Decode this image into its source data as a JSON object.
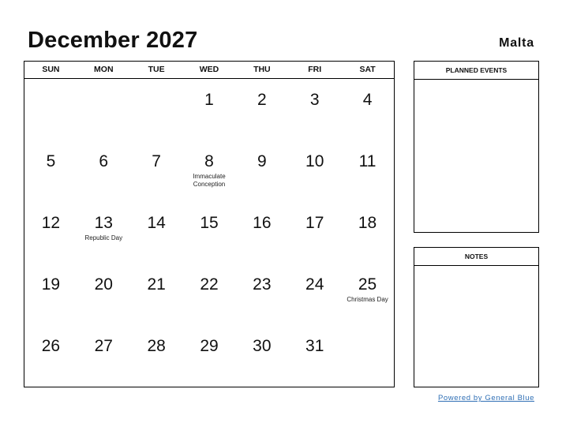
{
  "header": {
    "title": "December 2027",
    "country": "Malta"
  },
  "calendar": {
    "weekdays": [
      "SUN",
      "MON",
      "TUE",
      "WED",
      "THU",
      "FRI",
      "SAT"
    ],
    "weeks": [
      [
        {
          "day": ""
        },
        {
          "day": ""
        },
        {
          "day": ""
        },
        {
          "day": "1"
        },
        {
          "day": "2"
        },
        {
          "day": "3"
        },
        {
          "day": "4"
        }
      ],
      [
        {
          "day": "5"
        },
        {
          "day": "6"
        },
        {
          "day": "7"
        },
        {
          "day": "8",
          "holiday": "Immaculate Conception"
        },
        {
          "day": "9"
        },
        {
          "day": "10"
        },
        {
          "day": "11"
        }
      ],
      [
        {
          "day": "12"
        },
        {
          "day": "13",
          "holiday": "Republic Day"
        },
        {
          "day": "14"
        },
        {
          "day": "15"
        },
        {
          "day": "16"
        },
        {
          "day": "17"
        },
        {
          "day": "18"
        }
      ],
      [
        {
          "day": "19"
        },
        {
          "day": "20"
        },
        {
          "day": "21"
        },
        {
          "day": "22"
        },
        {
          "day": "23"
        },
        {
          "day": "24"
        },
        {
          "day": "25",
          "holiday": "Christmas Day"
        }
      ],
      [
        {
          "day": "26"
        },
        {
          "day": "27"
        },
        {
          "day": "28"
        },
        {
          "day": "29"
        },
        {
          "day": "30"
        },
        {
          "day": "31"
        },
        {
          "day": ""
        }
      ]
    ]
  },
  "side": {
    "planned_events_label": "PLANNED EVENTS",
    "notes_label": "NOTES"
  },
  "footer": {
    "powered_by": "Powered by General Blue",
    "link_color": "#2f6fb5"
  }
}
